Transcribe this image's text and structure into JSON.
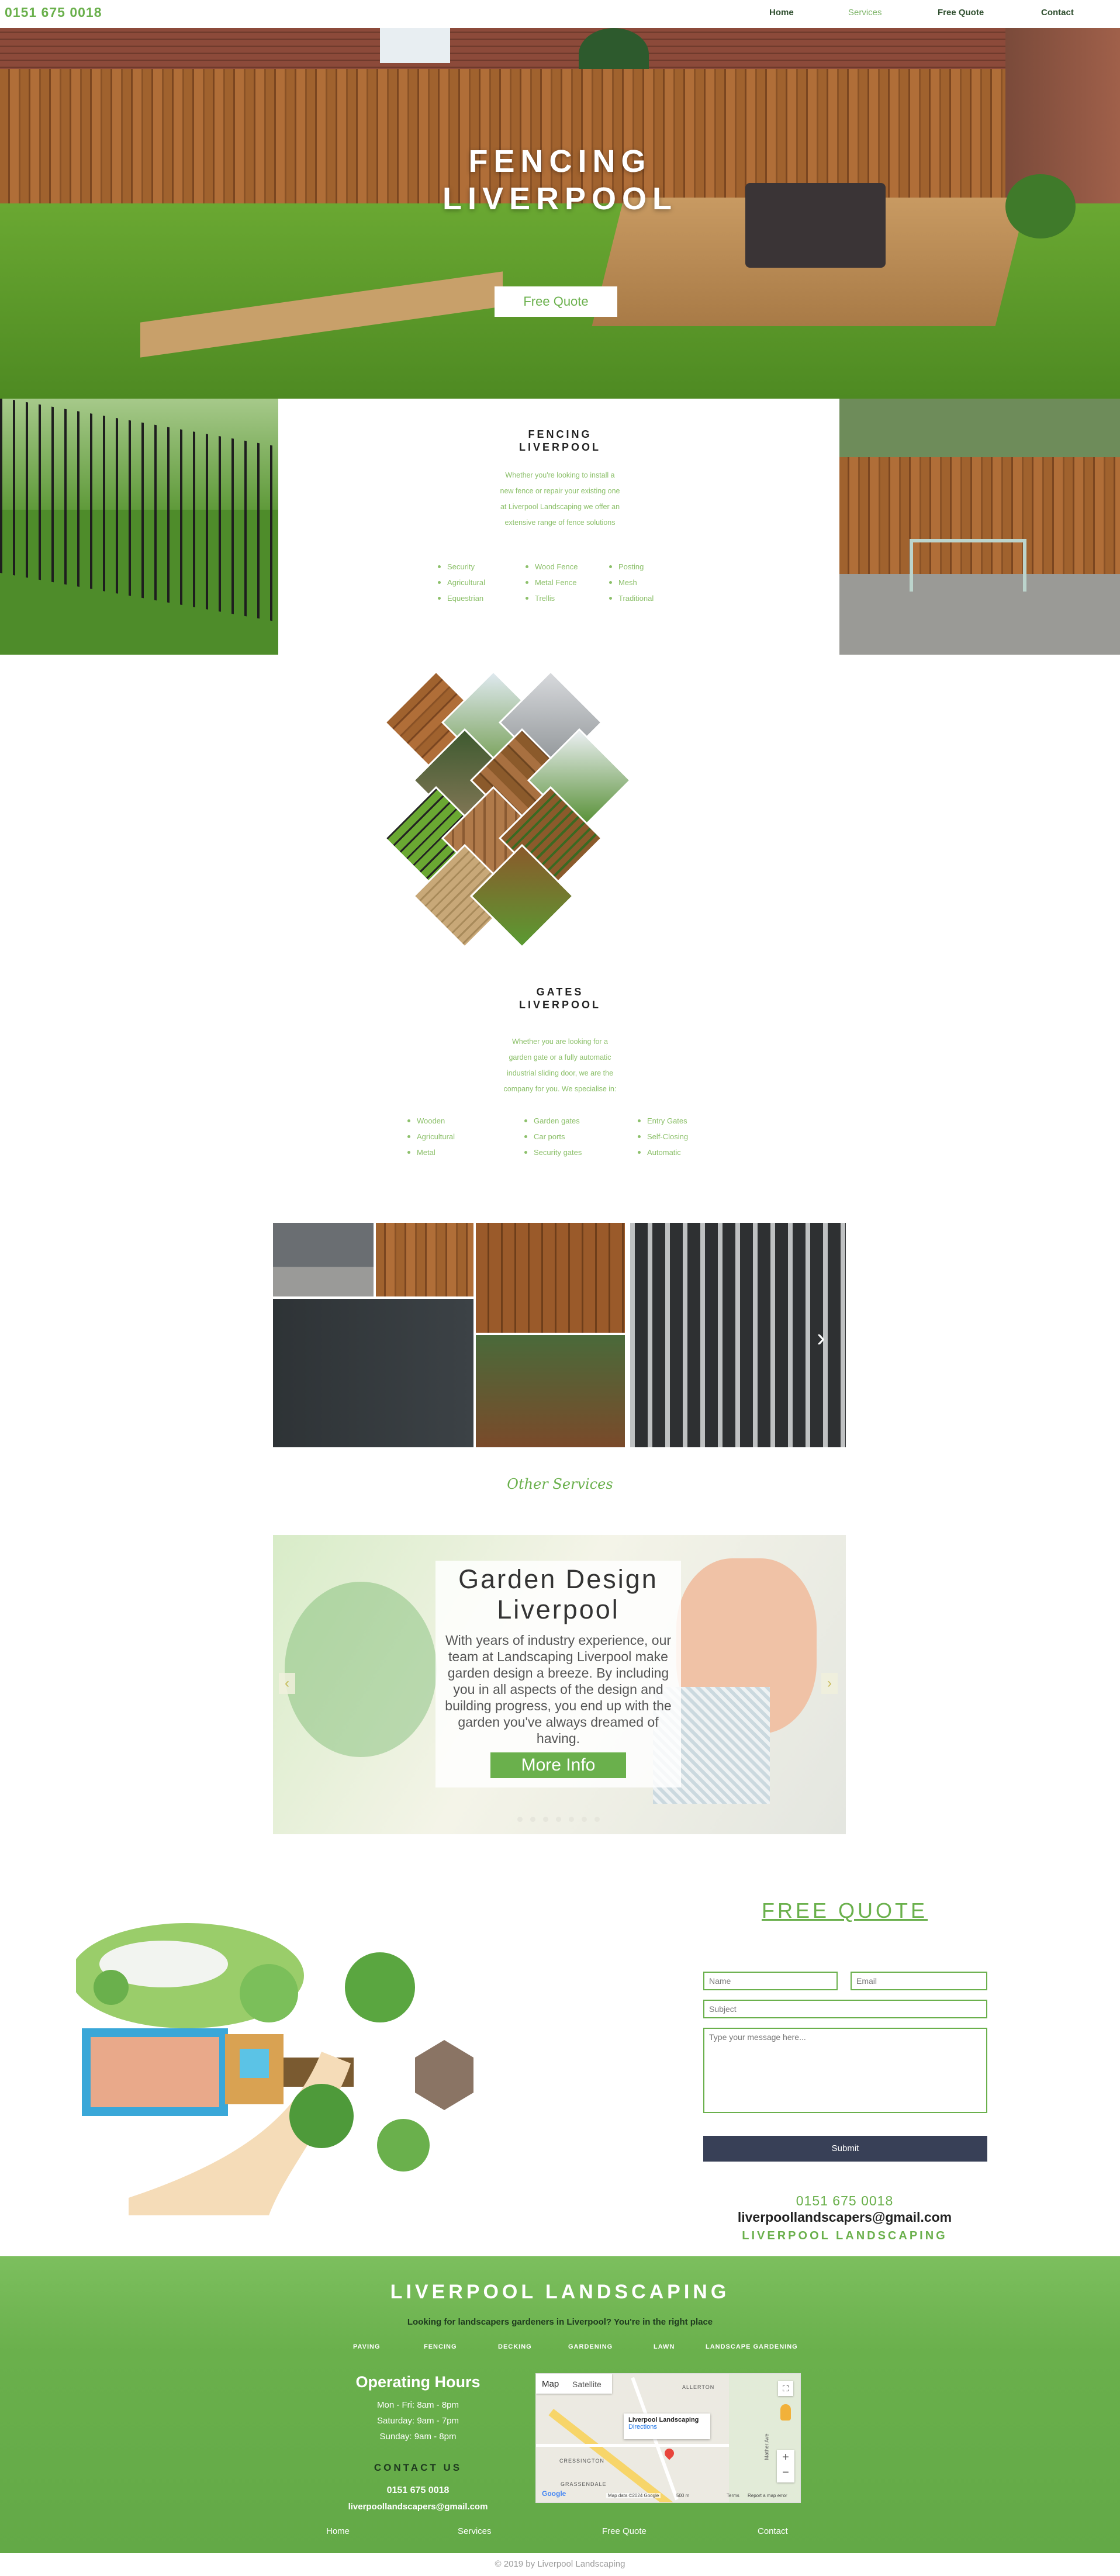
{
  "header": {
    "phone": "0151 675 0018",
    "nav": [
      {
        "label": "Home",
        "active": false
      },
      {
        "label": "Services",
        "active": true
      },
      {
        "label": "Free Quote",
        "active": false
      },
      {
        "label": "Contact",
        "active": false
      }
    ]
  },
  "hero": {
    "title_line1": "FENCING",
    "title_line2": "LIVERPOOL",
    "button": "Free Quote"
  },
  "fencing": {
    "title_line1": "FENCING",
    "title_line2": "LIVERPOOL",
    "description": [
      "Whether you're looking to install a",
      "new fence or repair your existing one",
      "at Liverpool Landscaping we offer an",
      "extensive range of fence solutions"
    ],
    "col1": [
      "Security",
      "Agricultural",
      "Equestrian"
    ],
    "col2": [
      "Wood Fence",
      "Metal Fence",
      "Trellis"
    ],
    "col3": [
      "Posting",
      "Mesh",
      "Traditional"
    ]
  },
  "gates": {
    "title_line1": "GATES",
    "title_line2": "LIVERPOOL",
    "description": [
      "Whether you are looking for a",
      "garden gate or a fully automatic",
      "industrial sliding door, we are the",
      "company for you. We specialise in:"
    ],
    "col1": [
      "Wooden",
      "Agricultural",
      "Metal"
    ],
    "col2": [
      "Garden gates",
      "Car ports",
      "Security gates"
    ],
    "col3": [
      "Entry Gates",
      "Self-Closing",
      "Automatic"
    ]
  },
  "other_services": "Other Services",
  "slideshow": {
    "title_line1": "Garden Design",
    "title_line2": "Liverpool",
    "text": "With years of industry experience, our team at Landscaping Liverpool make garden design a breeze. By including you in all aspects of the design and building progress, you end up with the garden you've always dreamed of having.",
    "button": "More Info",
    "prev_icon": "‹",
    "next_icon": "›",
    "dot_count": 7
  },
  "quote": {
    "title": "FREE QUOTE",
    "name_placeholder": "Name",
    "email_placeholder": "Email",
    "subject_placeholder": "Subject",
    "message_placeholder": "Type your message here...",
    "submit": "Submit",
    "phone": "0151 675 0018",
    "email": "liverpoollandscapers@gmail.com",
    "brand": "LIVERPOOL LANDSCAPING"
  },
  "footer": {
    "title": "LIVERPOOL LANDSCAPING",
    "tagline": "Looking for landscapers gardeners in Liverpool? You're in the right place",
    "service_links": [
      "PAVING",
      "FENCING",
      "DECKING",
      "GARDENING",
      "LAWN",
      "LANDSCAPE GARDENING"
    ],
    "hours_title": "Operating Hours",
    "hours": [
      "Mon - Fri: 8am - 8pm",
      "Saturday: 9am - 7pm",
      "Sunday: 9am - 8pm"
    ],
    "contact_title": "CONTACT US",
    "phone": "0151 675 0018",
    "email": "liverpoollandscapers@gmail.com",
    "map": {
      "tab_map": "Map",
      "tab_satellite": "Satellite",
      "place_name": "Liverpool Landscaping",
      "directions": "Directions",
      "label_allerton": "ALLERTON",
      "label_cressington": "CRESSINGTON",
      "label_grassendale": "GRASSENDALE",
      "label_road": "Mather Ave",
      "map_data": "Map data ©2024 Google",
      "scale": "500 m",
      "terms": "Terms",
      "report": "Report a map error",
      "google": "Google"
    },
    "bottom_nav": [
      "Home",
      "Services",
      "Free Quote",
      "Contact"
    ],
    "copyright": "© 2019 by Liverpool Landscaping"
  }
}
